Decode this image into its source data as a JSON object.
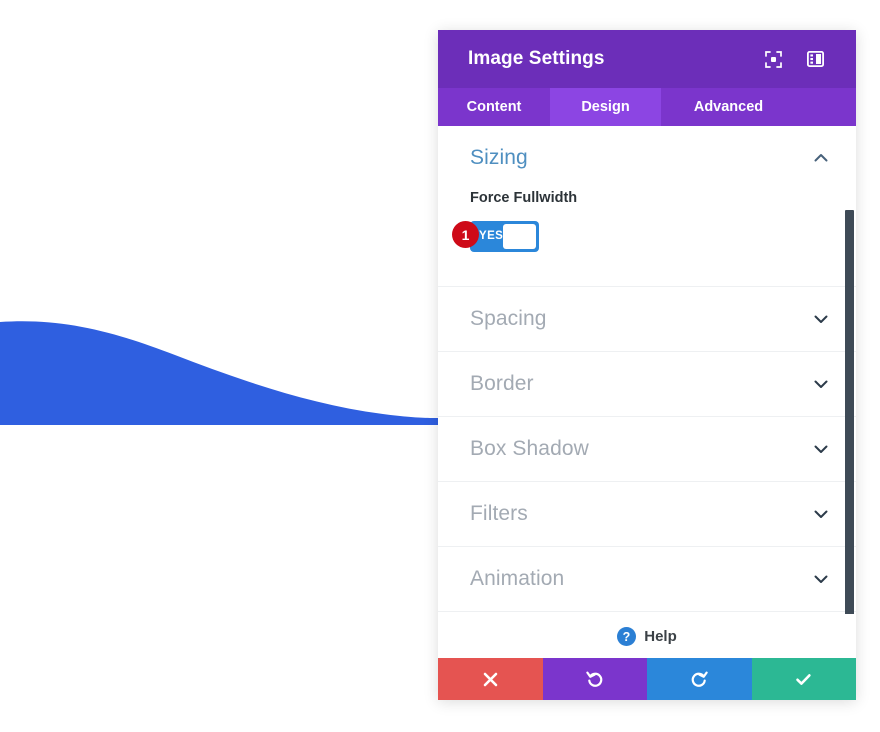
{
  "page": {
    "background_color": "#ffffff",
    "wave_color": "#2f5fe0"
  },
  "modal": {
    "title": "Image Settings",
    "header_color": "#6c2eb9",
    "header_icons": [
      {
        "name": "fullscreen-expand-icon",
        "label": "Expand"
      },
      {
        "name": "layout-panel-icon",
        "label": "Change Layout"
      }
    ],
    "tabs": [
      {
        "label": "Content",
        "active": false
      },
      {
        "label": "Design",
        "active": true
      },
      {
        "label": "Advanced",
        "active": false
      }
    ],
    "tab_bar_color": "#7b35cc",
    "tab_active_color": "#8c45e3",
    "sections": [
      {
        "label": "Sizing",
        "open": true,
        "chevron": "chevron-up-icon",
        "title_color": "#4f8fc0",
        "fields": [
          {
            "label": "Force Fullwidth",
            "type": "toggle",
            "value": "YES",
            "on": true,
            "accent_color": "#2b87da",
            "step_badge": "1",
            "step_badge_color": "#ce0a18"
          }
        ]
      },
      {
        "label": "Spacing",
        "open": false,
        "chevron": "chevron-down-icon",
        "title_color": "#a3aab3"
      },
      {
        "label": "Border",
        "open": false,
        "chevron": "chevron-down-icon",
        "title_color": "#a3aab3"
      },
      {
        "label": "Box Shadow",
        "open": false,
        "chevron": "chevron-down-icon",
        "title_color": "#a3aab3"
      },
      {
        "label": "Filters",
        "open": false,
        "chevron": "chevron-down-icon",
        "title_color": "#a3aab3"
      },
      {
        "label": "Animation",
        "open": false,
        "chevron": "chevron-down-icon",
        "title_color": "#a3aab3"
      }
    ],
    "help": {
      "label": "Help",
      "icon": "question-mark-circle-icon",
      "icon_color": "#2b7fd4"
    },
    "actions": [
      {
        "name": "cancel-button",
        "icon": "close-x-icon",
        "color": "#e55451"
      },
      {
        "name": "undo-button",
        "icon": "undo-arrow-icon",
        "color": "#7b35cc"
      },
      {
        "name": "redo-button",
        "icon": "redo-arrow-icon",
        "color": "#2b87da"
      },
      {
        "name": "save-button",
        "icon": "checkmark-icon",
        "color": "#2cb894"
      }
    ],
    "scrollbar": {
      "color": "#3e4a56",
      "visible": true
    }
  }
}
